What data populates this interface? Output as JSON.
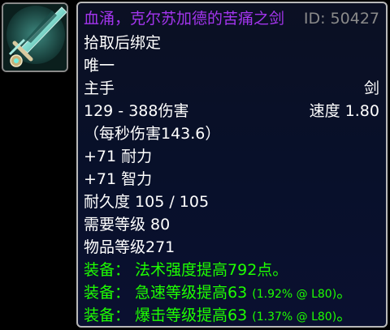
{
  "item": {
    "icon": "sword-icon",
    "name": "血涌，克尔苏加德的苦痛之剑",
    "id_label": "ID: 50427",
    "bind": "拾取后绑定",
    "unique": "唯一",
    "slot": "主手",
    "type": "剑",
    "damage": "129 - 388伤害",
    "speed": "速度 1.80",
    "dps": "（每秒伤害143.6）",
    "stamina": "+71 耐力",
    "intellect": "+71 智力",
    "durability": "耐久度 105 / 105",
    "required_level": "需要等级 80",
    "item_level": "物品等级271",
    "equip_spell_power": "装备： 法术强度提高792点。",
    "equip_haste_main": "装备： 急速等级提高63",
    "equip_haste_detail": "(1.92% @ L80)",
    "equip_crit_main": "装备： 爆击等级提高63",
    "equip_crit_detail": "(1.37% @ L80)",
    "period": "。"
  },
  "colors": {
    "epic": "#a335ee",
    "equip": "#1eff00",
    "id": "#8a8a8a",
    "background": "#0b1023",
    "border": "#b9b9b9"
  }
}
